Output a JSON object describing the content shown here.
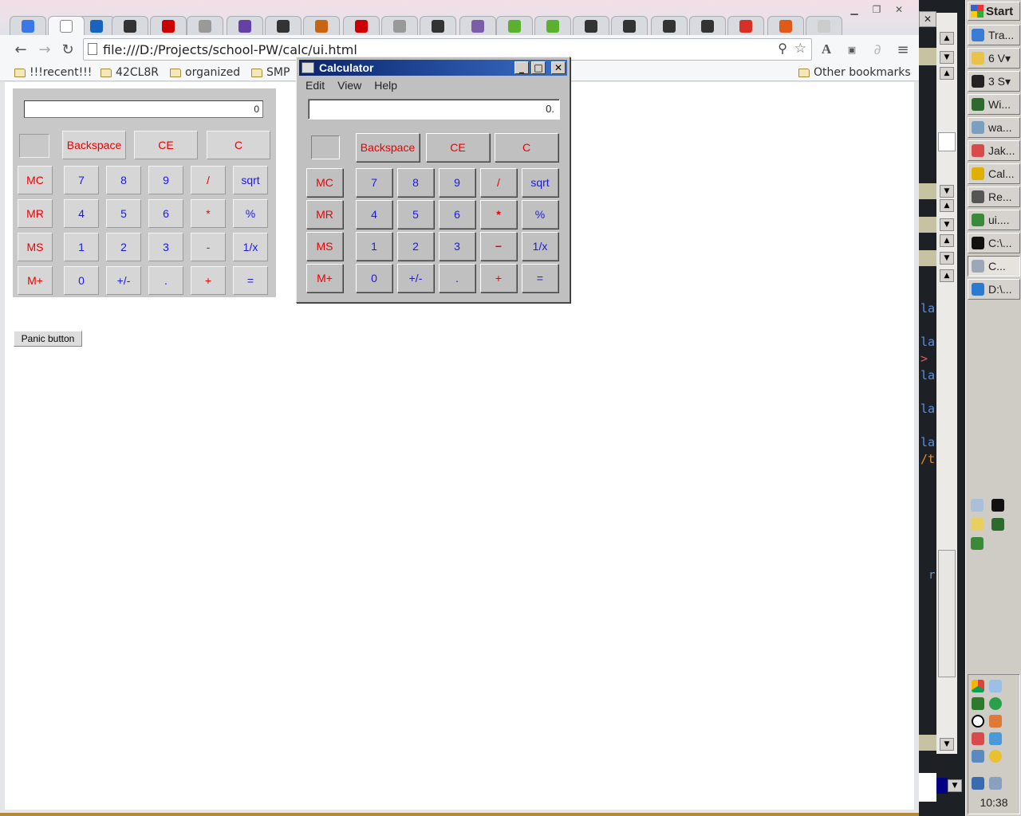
{
  "browser": {
    "tabs": [
      {
        "icon": "docs-icon",
        "color": "#3b78e7"
      },
      {
        "icon": "page-icon",
        "color": "#ffffff"
      },
      {
        "icon": "edge-icon",
        "color": "#1565c0"
      },
      {
        "icon": "github-icon",
        "color": "#333333"
      },
      {
        "icon": "youtube-icon",
        "color": "#cc0000"
      },
      {
        "icon": "mail-icon",
        "color": "#999999"
      },
      {
        "icon": "twitch-icon",
        "color": "#6441a5"
      },
      {
        "icon": "museum-icon",
        "color": "#333333"
      },
      {
        "icon": "history-icon",
        "color": "#c86414"
      },
      {
        "icon": "youtube-icon",
        "color": "#cc0000"
      },
      {
        "icon": "ogl-icon",
        "color": "#999999"
      },
      {
        "icon": "github-icon",
        "color": "#333333"
      },
      {
        "icon": "mail-icon",
        "color": "#7b5ea7"
      },
      {
        "icon": "w3-icon",
        "color": "#5bb030"
      },
      {
        "icon": "w3-icon",
        "color": "#5bb030"
      },
      {
        "icon": "github-icon",
        "color": "#333333"
      },
      {
        "icon": "github-icon",
        "color": "#333333"
      },
      {
        "icon": "github-icon",
        "color": "#333333"
      },
      {
        "icon": "github-icon",
        "color": "#333333"
      },
      {
        "icon": "gmail-icon",
        "color": "#d93025"
      },
      {
        "icon": "download-icon",
        "color": "#e05a1a"
      },
      {
        "icon": "blank-icon",
        "color": "#cccccc"
      }
    ],
    "url": "file:///D:/Projects/school-PW/calc/ui.html",
    "bookmarks": [
      "!!!recent!!!",
      "42CL8R",
      "organized",
      "SMP"
    ],
    "other_bookmarks": "Other bookmarks"
  },
  "html_calc": {
    "display": "0",
    "row0": [
      "Backspace",
      "CE",
      "C"
    ],
    "rows": [
      [
        "MC",
        "7",
        "8",
        "9",
        "/",
        "sqrt"
      ],
      [
        "MR",
        "4",
        "5",
        "6",
        "*",
        "%"
      ],
      [
        "MS",
        "1",
        "2",
        "3",
        "-",
        "1/x"
      ],
      [
        "M+",
        "0",
        "+/-",
        ".",
        "+",
        "="
      ]
    ],
    "panic": "Panic button"
  },
  "win_calc": {
    "title": "Calculator",
    "menu": [
      "Edit",
      "View",
      "Help"
    ],
    "display": "0.",
    "row0": [
      "Backspace",
      "CE",
      "C"
    ],
    "rows": [
      [
        "MC",
        "7",
        "8",
        "9",
        "/",
        "sqrt"
      ],
      [
        "MR",
        "4",
        "5",
        "6",
        "*",
        "%"
      ],
      [
        "MS",
        "1",
        "2",
        "3",
        "−",
        "1/x"
      ],
      [
        "M+",
        "0",
        "+/-",
        ".",
        "+",
        "="
      ]
    ]
  },
  "editor_fragments": [
    "la",
    "la",
    ">",
    "la",
    "la",
    "la",
    "/t",
    "r"
  ],
  "taskbar": {
    "start": "Start",
    "tasks": [
      {
        "label": "Tra...",
        "icon": "translate-icon",
        "color": "#3a7bd5"
      },
      {
        "label": "6 V▾",
        "icon": "folder-icon",
        "color": "#e8c24a"
      },
      {
        "label": "3 S▾",
        "icon": "pdf-icon",
        "color": "#222222"
      },
      {
        "label": "Wi...",
        "icon": "terminal-icon",
        "color": "#2d6a2d"
      },
      {
        "label": "wa...",
        "icon": "eraser-icon",
        "color": "#7aa0c0"
      },
      {
        "label": "Jak...",
        "icon": "paint-icon",
        "color": "#d94a4a"
      },
      {
        "label": "Cal...",
        "icon": "chrome-icon",
        "color": "#e0b000"
      },
      {
        "label": "Re...",
        "icon": "recorder-icon",
        "color": "#555555"
      },
      {
        "label": "ui....",
        "icon": "editor-icon",
        "color": "#3a8a3a"
      },
      {
        "label": "C:\\...",
        "icon": "cmd-icon",
        "color": "#111111"
      },
      {
        "label": "C...",
        "icon": "notepad-icon",
        "color": "#9aa8b8"
      },
      {
        "label": "D:\\...",
        "icon": "ie-icon",
        "color": "#2a7ad0"
      }
    ],
    "clock": "10:38"
  }
}
